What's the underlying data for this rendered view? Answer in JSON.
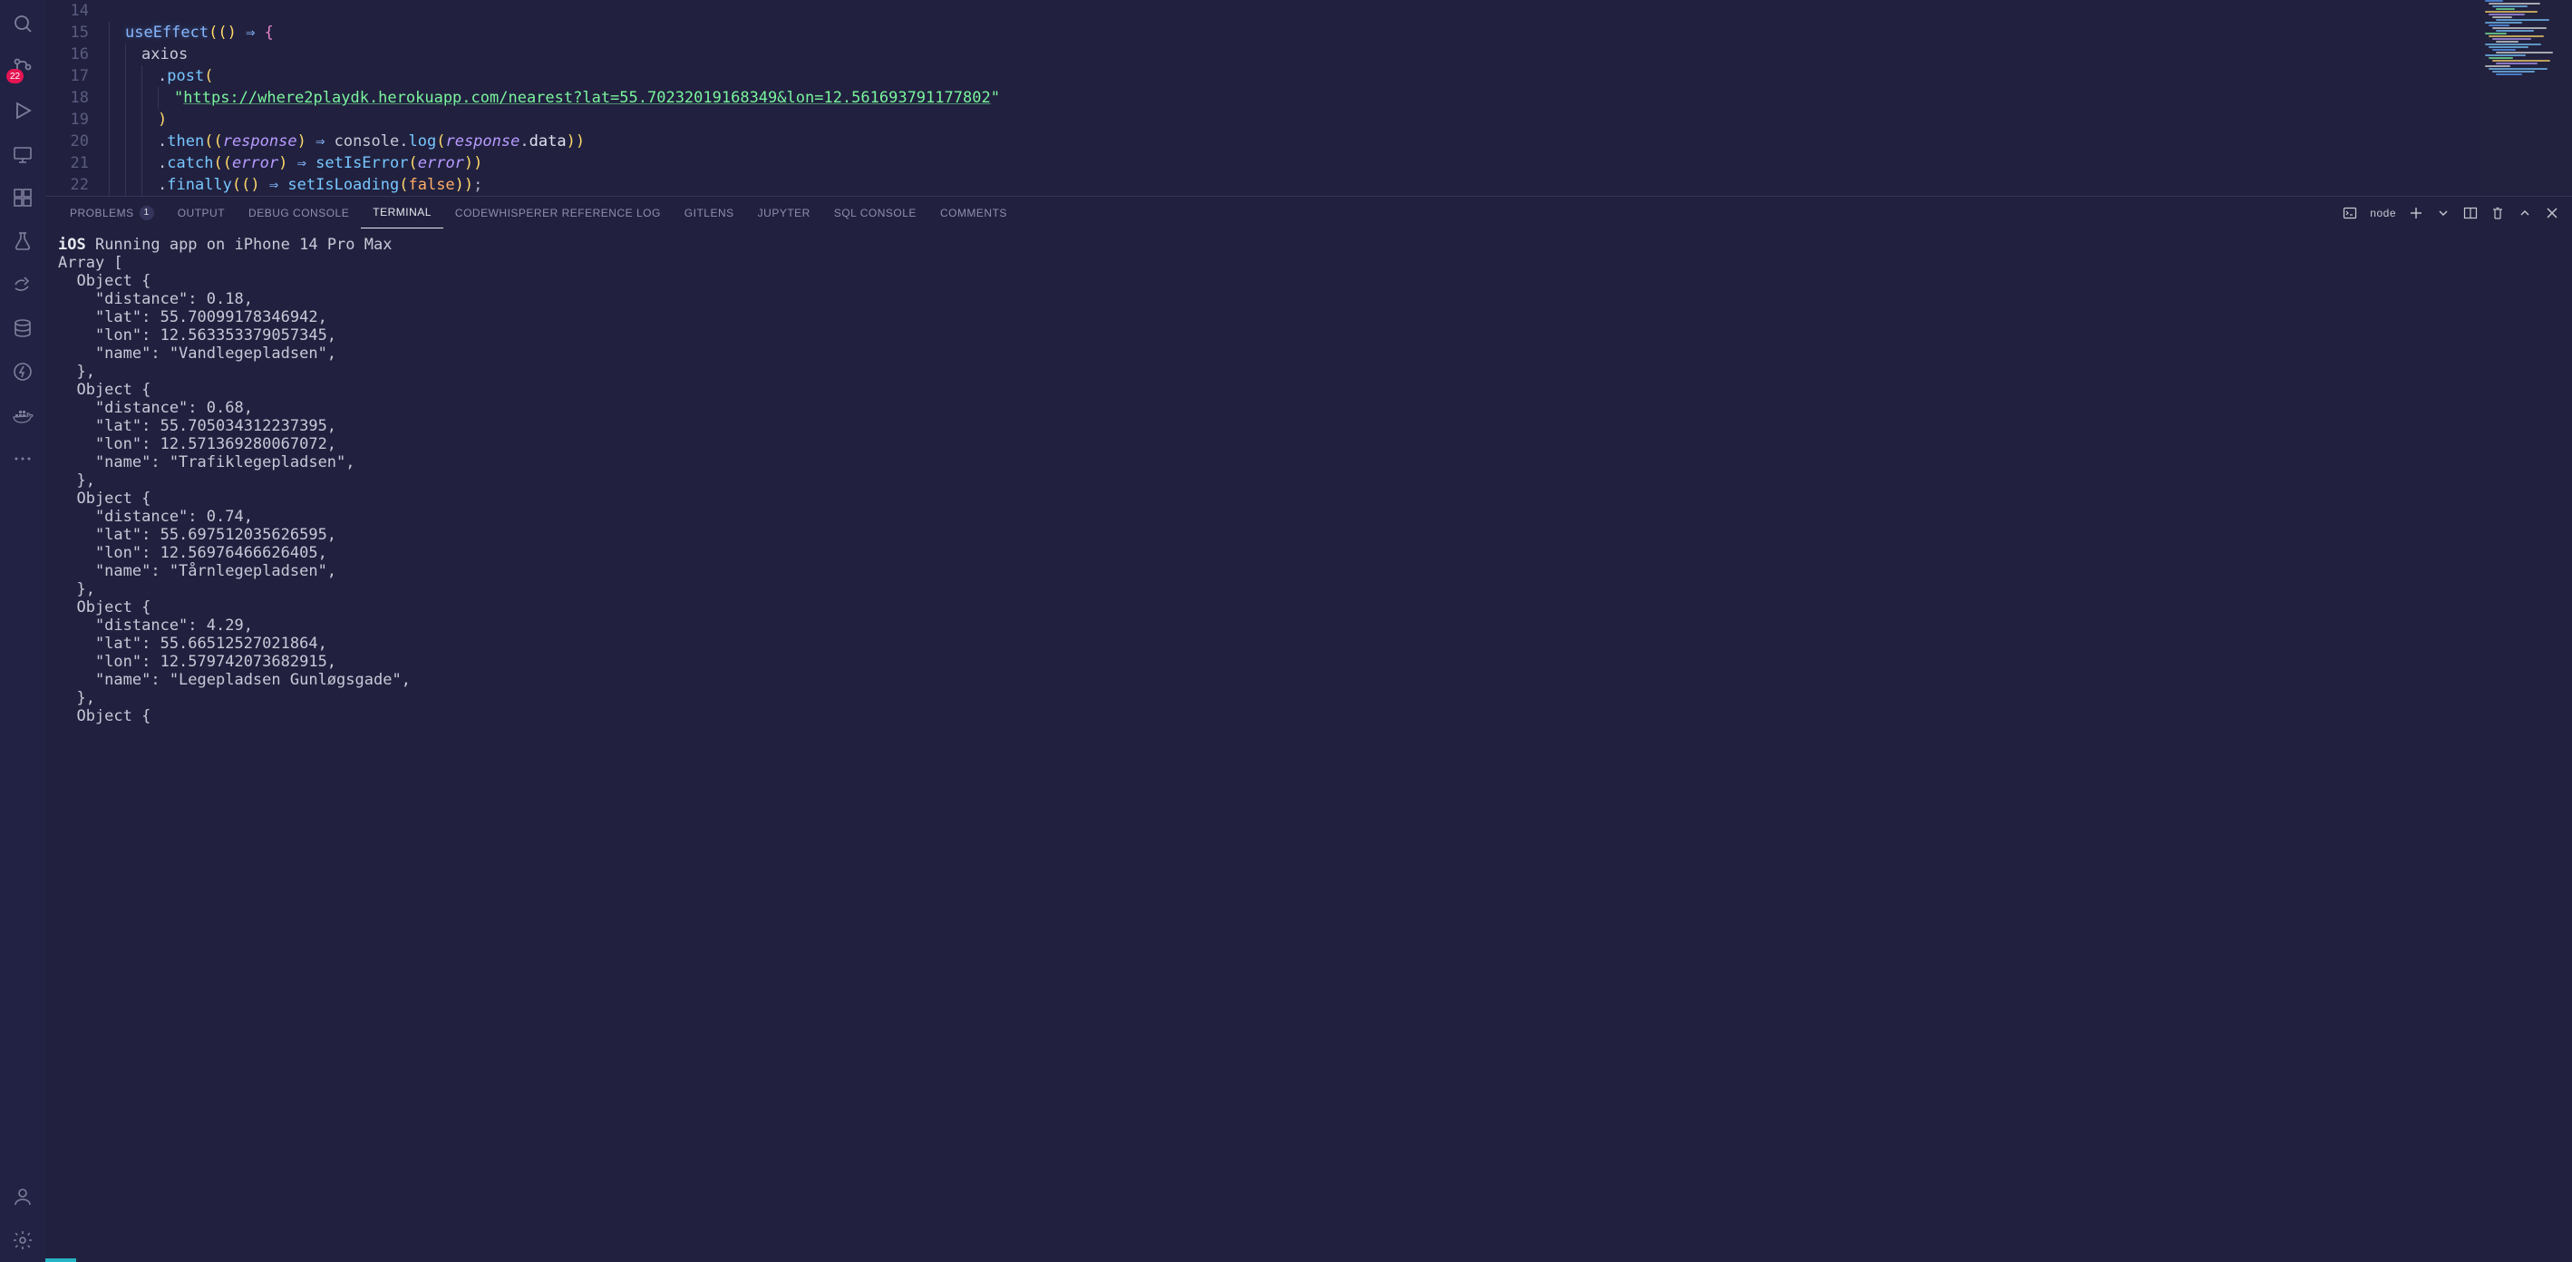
{
  "activity_bar": {
    "scm_badge": "22"
  },
  "editor": {
    "lines": [
      {
        "n": 14,
        "tokens": []
      },
      {
        "n": 15,
        "tokens": [
          {
            "t": "kw",
            "v": "useEffect"
          },
          {
            "t": "par",
            "v": "("
          },
          {
            "t": "par",
            "v": "("
          },
          {
            "t": "par",
            "v": ")"
          },
          {
            "t": "punc",
            "v": " "
          },
          {
            "t": "arrow",
            "v": "⇒"
          },
          {
            "t": "punc",
            "v": " "
          },
          {
            "t": "brace",
            "v": "{"
          }
        ],
        "indent": 1
      },
      {
        "n": 16,
        "tokens": [
          {
            "t": "id",
            "v": "axios"
          }
        ],
        "indent": 2
      },
      {
        "n": 17,
        "tokens": [
          {
            "t": "dot",
            "v": "."
          },
          {
            "t": "method",
            "v": "post"
          },
          {
            "t": "par",
            "v": "("
          }
        ],
        "indent": 3
      },
      {
        "n": 18,
        "tokens": [
          {
            "t": "str",
            "v": "\""
          },
          {
            "t": "url",
            "v": "https://where2playdk.herokuapp.com/nearest?lat=55.70232019168349&lon=12.561693791177802"
          },
          {
            "t": "str",
            "v": "\""
          }
        ],
        "indent": 4
      },
      {
        "n": 19,
        "tokens": [
          {
            "t": "par",
            "v": ")"
          }
        ],
        "indent": 3
      },
      {
        "n": 20,
        "tokens": [
          {
            "t": "dot",
            "v": "."
          },
          {
            "t": "method",
            "v": "then"
          },
          {
            "t": "par",
            "v": "("
          },
          {
            "t": "par",
            "v": "("
          },
          {
            "t": "param",
            "v": "response"
          },
          {
            "t": "par",
            "v": ")"
          },
          {
            "t": "punc",
            "v": " "
          },
          {
            "t": "arrow",
            "v": "⇒"
          },
          {
            "t": "punc",
            "v": " "
          },
          {
            "t": "id",
            "v": "console"
          },
          {
            "t": "dot",
            "v": "."
          },
          {
            "t": "method",
            "v": "log"
          },
          {
            "t": "par",
            "v": "("
          },
          {
            "t": "param",
            "v": "response"
          },
          {
            "t": "dot",
            "v": "."
          },
          {
            "t": "prop",
            "v": "data"
          },
          {
            "t": "par",
            "v": ")"
          },
          {
            "t": "par",
            "v": ")"
          }
        ],
        "indent": 3
      },
      {
        "n": 21,
        "tokens": [
          {
            "t": "dot",
            "v": "."
          },
          {
            "t": "method",
            "v": "catch"
          },
          {
            "t": "par",
            "v": "("
          },
          {
            "t": "par",
            "v": "("
          },
          {
            "t": "param",
            "v": "error"
          },
          {
            "t": "par",
            "v": ")"
          },
          {
            "t": "punc",
            "v": " "
          },
          {
            "t": "arrow",
            "v": "⇒"
          },
          {
            "t": "punc",
            "v": " "
          },
          {
            "t": "fn",
            "v": "setIsError"
          },
          {
            "t": "par",
            "v": "("
          },
          {
            "t": "param",
            "v": "error"
          },
          {
            "t": "par",
            "v": ")"
          },
          {
            "t": "par",
            "v": ")"
          }
        ],
        "indent": 3
      },
      {
        "n": 22,
        "tokens": [
          {
            "t": "dot",
            "v": "."
          },
          {
            "t": "method",
            "v": "finally"
          },
          {
            "t": "par",
            "v": "("
          },
          {
            "t": "par",
            "v": "("
          },
          {
            "t": "par",
            "v": ")"
          },
          {
            "t": "punc",
            "v": " "
          },
          {
            "t": "arrow",
            "v": "⇒"
          },
          {
            "t": "punc",
            "v": " "
          },
          {
            "t": "fn",
            "v": "setIsLoading"
          },
          {
            "t": "par",
            "v": "("
          },
          {
            "t": "const",
            "v": "false"
          },
          {
            "t": "par",
            "v": ")"
          },
          {
            "t": "par",
            "v": ")"
          },
          {
            "t": "punc",
            "v": ";"
          }
        ],
        "indent": 3
      }
    ]
  },
  "panel": {
    "tabs": [
      {
        "id": "problems",
        "label": "PROBLEMS",
        "badge": "1"
      },
      {
        "id": "output",
        "label": "OUTPUT"
      },
      {
        "id": "debug-console",
        "label": "DEBUG CONSOLE"
      },
      {
        "id": "terminal",
        "label": "TERMINAL",
        "active": true
      },
      {
        "id": "codewhisperer",
        "label": "CODEWHISPERER REFERENCE LOG"
      },
      {
        "id": "gitlens",
        "label": "GITLENS"
      },
      {
        "id": "jupyter",
        "label": "JUPYTER"
      },
      {
        "id": "sql-console",
        "label": "SQL CONSOLE"
      },
      {
        "id": "comments",
        "label": "COMMENTS"
      }
    ],
    "shell_label": "node"
  },
  "terminal": {
    "header_bold": "iOS",
    "header_rest": " Running app on iPhone 14 Pro Max",
    "objects": [
      {
        "distance": "0.18",
        "lat": "55.70099178346942",
        "lon": "12.563353379057345",
        "name": "Vandlegepladsen"
      },
      {
        "distance": "0.68",
        "lat": "55.705034312237395",
        "lon": "12.571369280067072",
        "name": "Trafiklegepladsen"
      },
      {
        "distance": "0.74",
        "lat": "55.697512035626595",
        "lon": "12.56976466626405",
        "name": "Tårnlegepladsen"
      },
      {
        "distance": "4.29",
        "lat": "55.66512527021864",
        "lon": "12.579742073682915",
        "name": "Legepladsen Gunløgsgade"
      }
    ]
  }
}
